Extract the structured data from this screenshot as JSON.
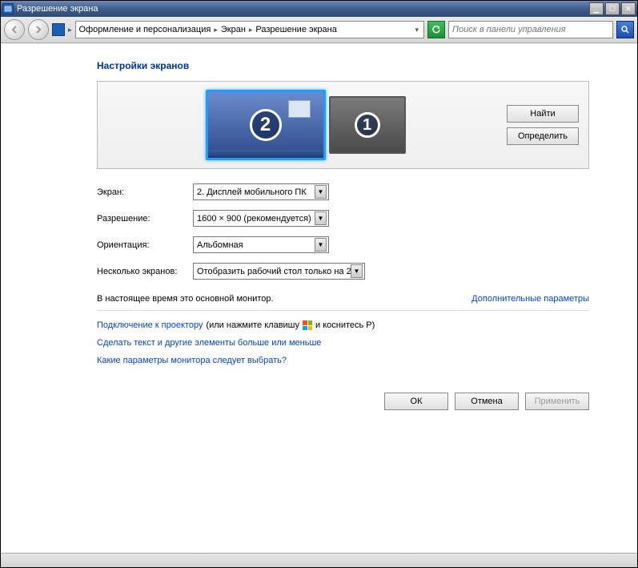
{
  "titlebar": {
    "title": "Разрешение экрана"
  },
  "breadcrumb": {
    "seg1": "Оформление и персонализация",
    "seg2": "Экран",
    "seg3": "Разрешение экрана"
  },
  "search": {
    "placeholder": "Поиск в панели управления"
  },
  "page": {
    "heading": "Настройки экранов"
  },
  "panel": {
    "monitor_primary_num": "2",
    "monitor_secondary_num": "1",
    "detect_btn": "Найти",
    "identify_btn": "Определить"
  },
  "form": {
    "display_label": "Экран:",
    "display_value": "2. Дисплей мобильного ПК",
    "resolution_label": "Разрешение:",
    "resolution_value": "1600 × 900 (рекомендуется)",
    "orientation_label": "Ориентация:",
    "orientation_value": "Альбомная",
    "multi_label": "Несколько экранов:",
    "multi_value": "Отобразить рабочий стол только на 2"
  },
  "status": {
    "primary_text": "В настоящее время это основной монитор.",
    "advanced_link": "Дополнительные параметры"
  },
  "links": {
    "projector_pre": "Подключение к проектору",
    "projector_mid": " (или нажмите клавишу ",
    "projector_post": " и коснитесь P)",
    "textsize": "Сделать текст и другие элементы больше или меньше",
    "whichmonitor": "Какие параметры монитора следует выбрать?"
  },
  "buttons": {
    "ok": "ОК",
    "cancel": "Отмена",
    "apply": "Применить"
  }
}
